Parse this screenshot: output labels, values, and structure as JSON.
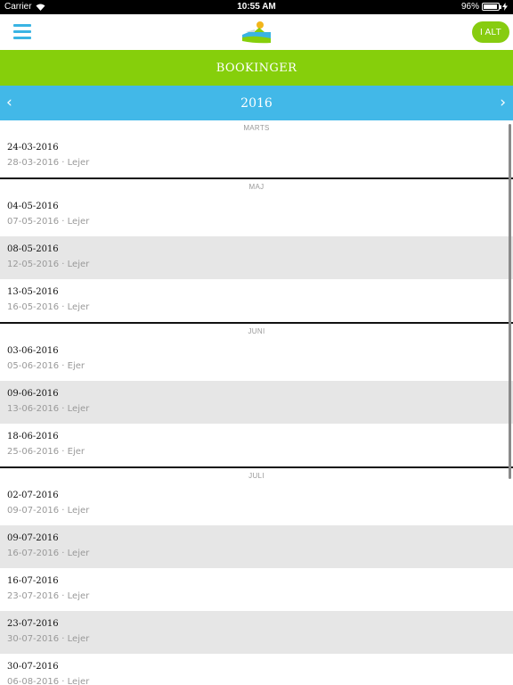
{
  "status_bar": {
    "carrier": "Carrier",
    "time": "10:55 AM",
    "battery_text": "96%",
    "battery_level": 0.96
  },
  "nav": {
    "menu_icon": "hamburger-menu-icon",
    "logo": "app-logo",
    "right_button": "I ALT"
  },
  "title": "BOOKINGER",
  "year_nav": {
    "year": "2016",
    "prev": "‹",
    "next": "›"
  },
  "sections": [
    {
      "month": "MARTS",
      "items": [
        {
          "date": "24-03-2016",
          "sub": "28-03-2016 · Lejer"
        }
      ]
    },
    {
      "month": "MAJ",
      "items": [
        {
          "date": "04-05-2016",
          "sub": "07-05-2016 · Lejer"
        },
        {
          "date": "08-05-2016",
          "sub": "12-05-2016 · Lejer"
        },
        {
          "date": "13-05-2016",
          "sub": "16-05-2016 · Lejer"
        }
      ]
    },
    {
      "month": "JUNI",
      "items": [
        {
          "date": "03-06-2016",
          "sub": "05-06-2016 · Ejer"
        },
        {
          "date": "09-06-2016",
          "sub": "13-06-2016 · Lejer"
        },
        {
          "date": "18-06-2016",
          "sub": "25-06-2016 · Ejer"
        }
      ]
    },
    {
      "month": "JULI",
      "items": [
        {
          "date": "02-07-2016",
          "sub": "09-07-2016 · Lejer"
        },
        {
          "date": "09-07-2016",
          "sub": "16-07-2016 · Lejer"
        },
        {
          "date": "16-07-2016",
          "sub": "23-07-2016 · Lejer"
        },
        {
          "date": "23-07-2016",
          "sub": "30-07-2016 · Lejer"
        },
        {
          "date": "30-07-2016",
          "sub": "06-08-2016 · Lejer"
        }
      ]
    }
  ],
  "colors": {
    "accent_green": "#86cf0b",
    "accent_blue": "#42b8e8",
    "row_alt": "#e6e6e6"
  }
}
